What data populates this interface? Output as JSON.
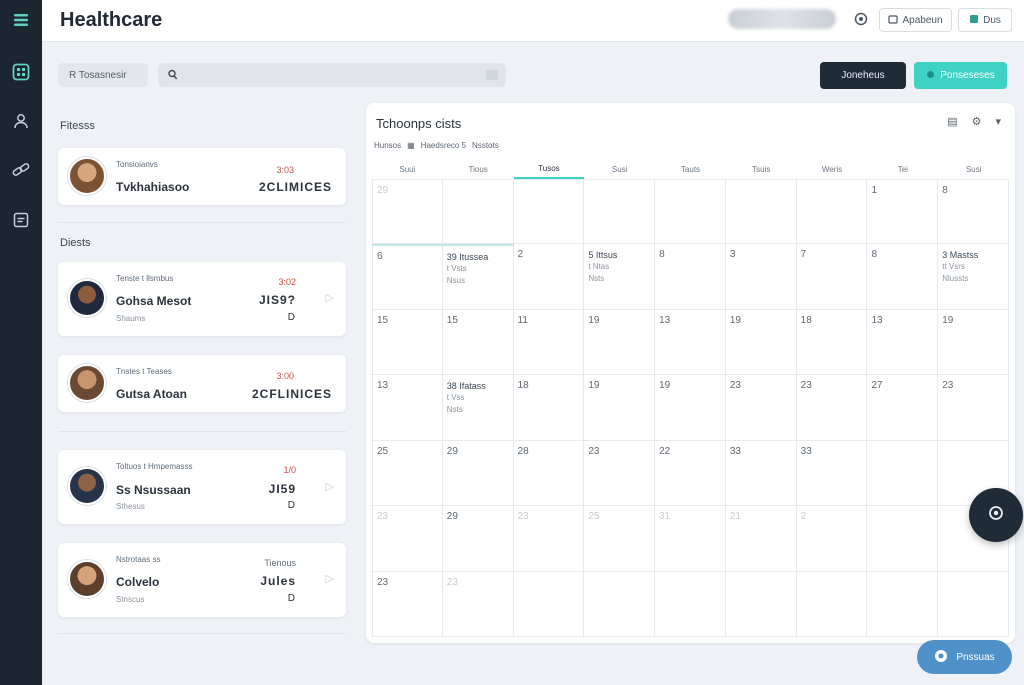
{
  "app": {
    "title": "Healthcare"
  },
  "topbar": {
    "btn1_label": "Apabeun",
    "btn2_label": "Dus"
  },
  "toolbar": {
    "filter_label": "R Tosasnesir",
    "search_placeholder": "",
    "dark_button_label": "Joneheus",
    "teal_button_label": "Ponseseses"
  },
  "sections": {
    "first": "Fitesss",
    "second": "Diests"
  },
  "cards": [
    {
      "sup": "Tonsioianvs",
      "name": "Tvkhahiasoo",
      "sub": "",
      "right_small": "3:03",
      "right_big": "2CLIMICES",
      "right_small_color": "#c0564f",
      "date": "",
      "arrow": false
    },
    {
      "sup": "Tenste t llsmbus",
      "name": "Gohsa Mesot",
      "sub": "Shaums",
      "right_small": "3:02",
      "right_big": "JIS9?",
      "right_small_color": "#d64a3f",
      "date": "D",
      "arrow": true
    },
    {
      "sup": "Tnstes t Teases",
      "name": "Gutsa Atoan",
      "sub": "",
      "right_small": "3:00",
      "right_big": "2CFLINICES",
      "right_small_color": "#c0564f",
      "date": "",
      "arrow": false
    },
    {
      "sup": "Toltuos t Hmpemasss",
      "name": "Ss Nsussaan",
      "sub": "Sthesus",
      "right_small": "1/0",
      "right_big": "JI59",
      "right_small_color": "#d64a3f",
      "date": "D",
      "arrow": true
    },
    {
      "sup": "Nstrotaas ss",
      "name": "Colvelo",
      "sub": "Stnscus",
      "right_small": "Tienous",
      "right_big": "Jules",
      "right_small_color": "#5f6b77",
      "date": "D",
      "arrow": true
    }
  ],
  "calendar": {
    "title": "Tchoonps cists",
    "subheader": [
      "Hunsos",
      "Haedsreco 5",
      "Nsstots"
    ],
    "weekdays": [
      "Suui",
      "Tious",
      "Tusos",
      "Susi",
      "Tauts",
      "Tsuis",
      "Weris",
      "Tei",
      "Susi"
    ],
    "rows": [
      [
        "29",
        "",
        "",
        "",
        "",
        "",
        "",
        "1",
        "8"
      ],
      [
        "6",
        "",
        "2",
        "",
        "8",
        "3",
        "7",
        "8",
        ""
      ],
      [
        "15",
        "15",
        "11",
        "19",
        "13",
        "19",
        "18",
        "13",
        "19"
      ],
      [
        "13",
        "",
        "18",
        "19",
        "19",
        "23",
        "23",
        "27",
        "23"
      ],
      [
        "25",
        "29",
        "28",
        "23",
        "22",
        "33",
        "33",
        "",
        ""
      ],
      [
        "23",
        "29",
        "23",
        "25",
        "31",
        "21",
        "2",
        "",
        ""
      ],
      [
        "23",
        "23",
        "",
        "",
        "",
        "",
        "",
        "",
        ""
      ]
    ],
    "faint_days": {
      "0": [
        0,
        1,
        2,
        3,
        4,
        5,
        6
      ],
      "4": [
        7,
        8
      ],
      "5": [
        0,
        2,
        3,
        4,
        5,
        6
      ],
      "6": [
        1
      ]
    },
    "events": [
      {
        "row": 1,
        "col": 1,
        "l1": "39 Itussea",
        "l2": "t Vsts",
        "l3": "Nsus"
      },
      {
        "row": 1,
        "col": 3,
        "l1": "5 Ittsus",
        "l2": "t Ntas",
        "l3": "Nsts"
      },
      {
        "row": 1,
        "col": 8,
        "l1": "3 Mastss",
        "l2": "tt Vsrs",
        "l3": "Nlussts"
      },
      {
        "row": 3,
        "col": 1,
        "l1": "38 Ifatass",
        "l2": "t Vss",
        "l3": "Nsts"
      }
    ]
  },
  "assistant_pill": {
    "label": "Pnssuas"
  },
  "colors": {
    "rail": "#1b2630",
    "teal": "#3ed1c4",
    "dark": "#1f2b36",
    "pill": "#4e92c9"
  }
}
